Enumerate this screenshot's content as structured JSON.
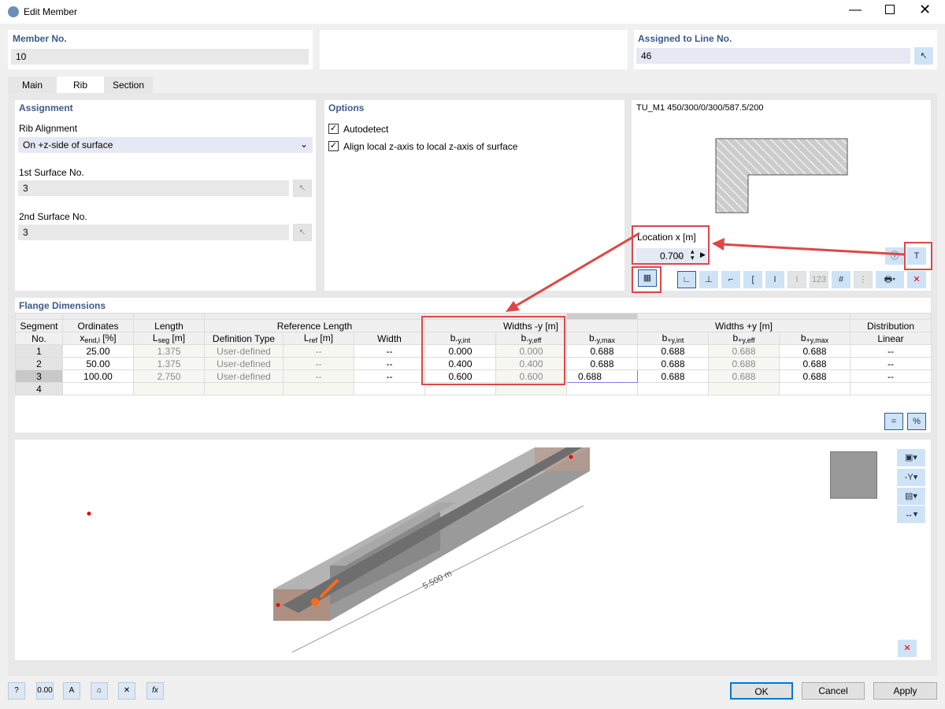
{
  "window": {
    "title": "Edit Member"
  },
  "member_no": {
    "label": "Member No.",
    "value": "10"
  },
  "assigned_line": {
    "label": "Assigned to Line No.",
    "value": "46"
  },
  "tabs": [
    {
      "label": "Main"
    },
    {
      "label": "Rib"
    },
    {
      "label": "Section"
    }
  ],
  "assignment": {
    "title": "Assignment",
    "rib_alignment_label": "Rib Alignment",
    "rib_alignment_value": "On +z-side of surface",
    "surface1_label": "1st Surface No.",
    "surface1_value": "3",
    "surface2_label": "2nd Surface No.",
    "surface2_value": "3"
  },
  "options": {
    "title": "Options",
    "autodetect": {
      "label": "Autodetect",
      "checked": true
    },
    "align": {
      "label": "Align local z-axis to local z-axis of surface",
      "checked": true
    }
  },
  "section": {
    "name": "TU_M1 450/300/0/300/587.5/200",
    "location_label": "Location x [m]",
    "location_value": "0.700"
  },
  "flange": {
    "title": "Flange Dimensions",
    "headers": {
      "segment": "Segment",
      "no": "No.",
      "ordinates": "Ordinates",
      "xend": "x",
      "xend_sub": "end,l",
      "xend_unit": " [%]",
      "length": "Length",
      "lseg": "L",
      "lseg_sub": "seg",
      "lseg_unit": " [m]",
      "reference_length": "Reference Length",
      "definition_type": "Definition Type",
      "lref": "L",
      "lref_sub": "ref",
      "lref_unit": " [m]",
      "width": "Width",
      "widths_neg": "Widths -y [m]",
      "bnyint": "-y,int",
      "bnyeff": "-y,eff",
      "bnymax": "-y,max",
      "widths_pos": "Widths +y [m]",
      "bpyint": "+y,int",
      "bpyeff": "+y,eff",
      "bpymax": "+y,max",
      "distribution": "Distribution",
      "linear": "Linear",
      "b": "b"
    },
    "rows": [
      {
        "no": "1",
        "x": "25.00",
        "lseg": "1.375",
        "type": "User-defined",
        "lref": "--",
        "width": "--",
        "bnint": "0.000",
        "bneff": "0.000",
        "bnmax": "0.688",
        "bpint": "0.688",
        "bpeff": "0.688",
        "bpmax": "0.688",
        "lin": "--"
      },
      {
        "no": "2",
        "x": "50.00",
        "lseg": "1.375",
        "type": "User-defined",
        "lref": "--",
        "width": "--",
        "bnint": "0.400",
        "bneff": "0.400",
        "bnmax": "0.688",
        "bpint": "0.688",
        "bpeff": "0.688",
        "bpmax": "0.688",
        "lin": "--"
      },
      {
        "no": "3",
        "x": "100.00",
        "lseg": "2.750",
        "type": "User-defined",
        "lref": "--",
        "width": "--",
        "bnint": "0.600",
        "bneff": "0.600",
        "bnmax": "0.688",
        "bpint": "0.688",
        "bpeff": "0.688",
        "bpmax": "0.688",
        "lin": "--"
      },
      {
        "no": "4"
      }
    ]
  },
  "view": {
    "dimension": "5.500 m"
  },
  "buttons": {
    "ok": "OK",
    "cancel": "Cancel",
    "apply": "Apply",
    "units": "0.00"
  },
  "colors": {
    "highlight": "#e04646",
    "accent": "#3c5a8a",
    "arrow": "#ff6a1a"
  }
}
